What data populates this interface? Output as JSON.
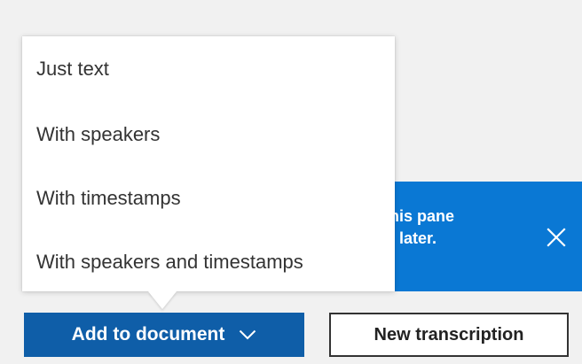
{
  "menu": {
    "items": [
      {
        "label": "Just text"
      },
      {
        "label": "With speakers"
      },
      {
        "label": "With timestamps"
      },
      {
        "label": "With speakers and timestamps"
      }
    ]
  },
  "banner": {
    "line1": "e this pane",
    "line2": "o it later.",
    "close_icon": "close-icon",
    "background": "#0a78d4"
  },
  "buttons": {
    "add_to_document": "Add to document",
    "add_to_document_icon": "chevron-down-icon",
    "new_transcription": "New transcription"
  },
  "colors": {
    "primary_button": "#0f5ea8",
    "banner": "#0a78d4",
    "menu_background": "#ffffff",
    "page_background": "#f1f1f1"
  }
}
